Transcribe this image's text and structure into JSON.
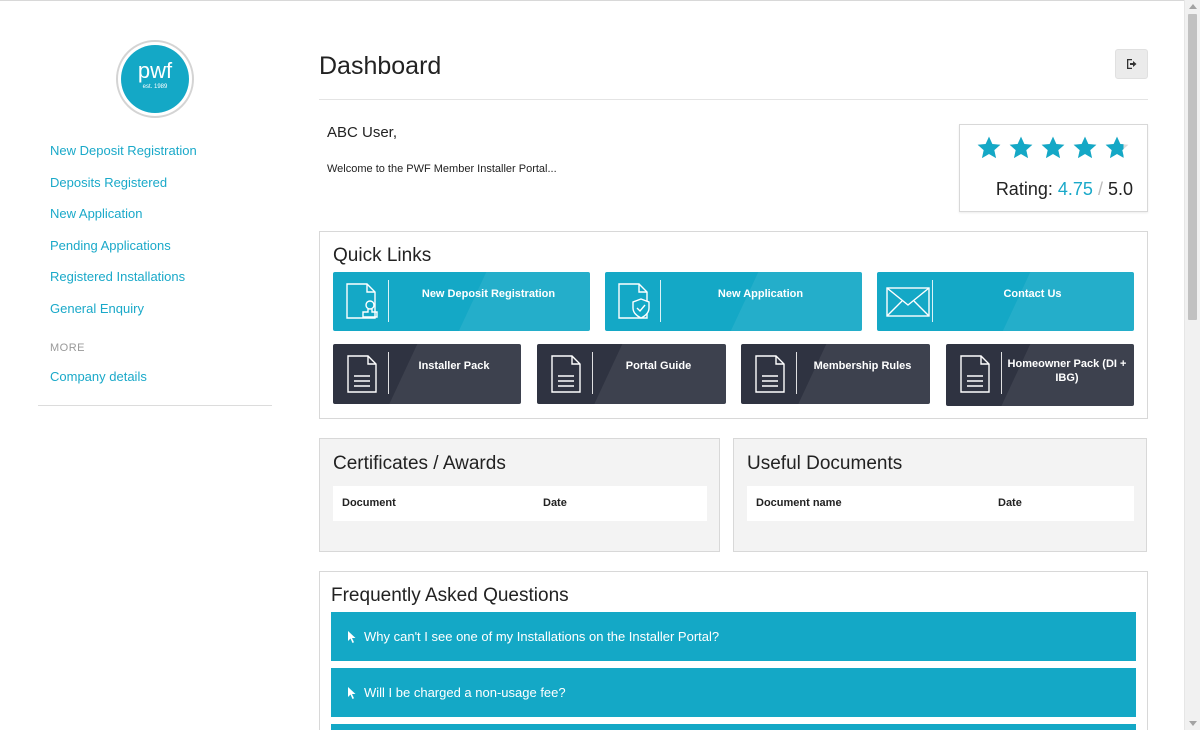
{
  "brand": {
    "logo_text": "pwf",
    "logo_sub": "est. 1989",
    "accent": "#14a8c6",
    "dark_tile": "#2f3341"
  },
  "sidebar": {
    "items": [
      {
        "label": "New Deposit Registration"
      },
      {
        "label": "Deposits Registered"
      },
      {
        "label": "New Application"
      },
      {
        "label": "Pending Applications"
      },
      {
        "label": "Registered Installations"
      },
      {
        "label": "General Enquiry"
      }
    ],
    "more_heading": "MORE",
    "more_items": [
      {
        "label": "Company details"
      }
    ]
  },
  "header": {
    "title": "Dashboard",
    "logout_icon": "sign-out-icon"
  },
  "welcome": {
    "greeting": "ABC User,",
    "message": "Welcome to the PWF Member Installer Portal..."
  },
  "rating": {
    "label": "Rating:",
    "value": "4.75",
    "separator": "/",
    "max": "5.0",
    "stars_value": 4.75,
    "stars_total": 5
  },
  "quick_links": {
    "title": "Quick Links",
    "primary": [
      {
        "label": "New Deposit Registration",
        "icon": "document-stamp-icon"
      },
      {
        "label": "New Application",
        "icon": "document-shield-icon"
      },
      {
        "label": "Contact Us",
        "icon": "envelope-icon"
      }
    ],
    "secondary": [
      {
        "label": "Installer Pack",
        "icon": "document-icon"
      },
      {
        "label": "Portal Guide",
        "icon": "document-icon"
      },
      {
        "label": "Membership Rules",
        "icon": "document-icon"
      },
      {
        "label": "Homeowner Pack (DI + IBG)",
        "icon": "document-icon"
      }
    ]
  },
  "certificates": {
    "title": "Certificates / Awards",
    "columns": [
      "Document",
      "Date"
    ]
  },
  "useful_documents": {
    "title": "Useful Documents",
    "columns": [
      "Document name",
      "Date"
    ]
  },
  "faq": {
    "title": "Frequently Asked Questions",
    "items": [
      {
        "question": "Why can't I see one of my Installations on the Installer Portal?"
      },
      {
        "question": "Will I be charged a non-usage fee?"
      }
    ]
  }
}
